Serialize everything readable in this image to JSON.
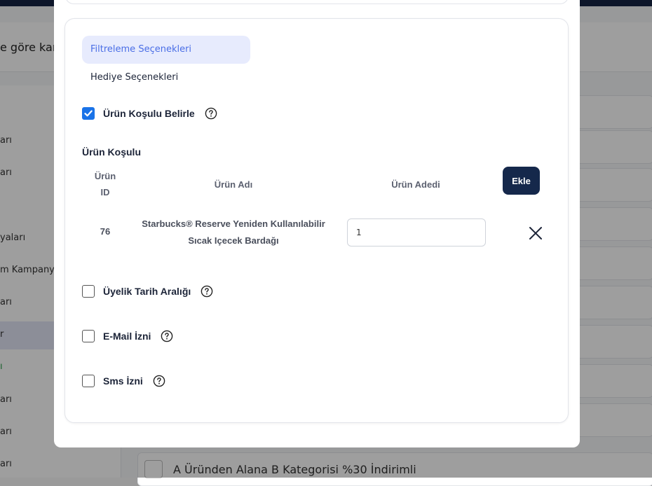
{
  "background": {
    "header_text": "e göre kam",
    "sidebar_items": [
      "arı",
      "arı",
      "yaları",
      "m Kampanya",
      "arı",
      "r",
      "ı",
      "arı",
      "arı",
      "arı"
    ],
    "row_title": "A Üründen Alana B Kategorisi %30 İndirimli"
  },
  "tabs": [
    "Filtreleme Seçenekleri",
    "Hediye Seçenekleri"
  ],
  "product_condition": {
    "checkbox_label": "Ürün Koşulu Belirle",
    "checked": true,
    "section_title": "Ürün Koşulu",
    "columns": {
      "id_line1": "Ürün",
      "id_line2": "ID",
      "name": "Ürün Adı",
      "qty": "Ürün Adedi"
    },
    "add_button": "Ekle",
    "rows": [
      {
        "id": "76",
        "name_line1": "Starbucks® Reserve Yeniden Kullanılabilir",
        "name_line2": "Sıcak Içecek Bardağı",
        "qty": "1"
      }
    ]
  },
  "filters": [
    {
      "label": "Üyelik Tarih Aralığı",
      "checked": false
    },
    {
      "label": "E-Mail İzni",
      "checked": false
    },
    {
      "label": "Sms İzni",
      "checked": false
    }
  ],
  "icons": {
    "help": "question-circle-icon",
    "check": "checkmark-icon",
    "close": "close-icon"
  },
  "colors": {
    "primary_button": "#15284b",
    "checkbox_checked": "#1a73e8",
    "tab_active_bg": "#e7ebfd",
    "tab_active_text": "#4a6ee6"
  }
}
